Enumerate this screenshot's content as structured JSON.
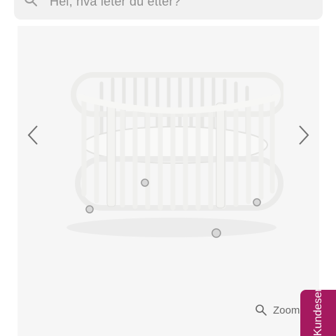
{
  "search": {
    "placeholder": "Hei, hva leter du etter?",
    "icon": "search-icon"
  },
  "gallery": {
    "image_alt": "White oval baby crib on wheels",
    "prev_icon": "chevron-left-icon",
    "next_icon": "chevron-right-icon",
    "zoom_label": "Zoom",
    "zoom_icon": "zoom-icon"
  },
  "service_tab": {
    "label": "Kundeservice",
    "color": "#a5195f"
  },
  "colors": {
    "gallery_bg": "#f6f6f6",
    "search_bg": "#f1f1f1",
    "accent": "#a5195f"
  }
}
